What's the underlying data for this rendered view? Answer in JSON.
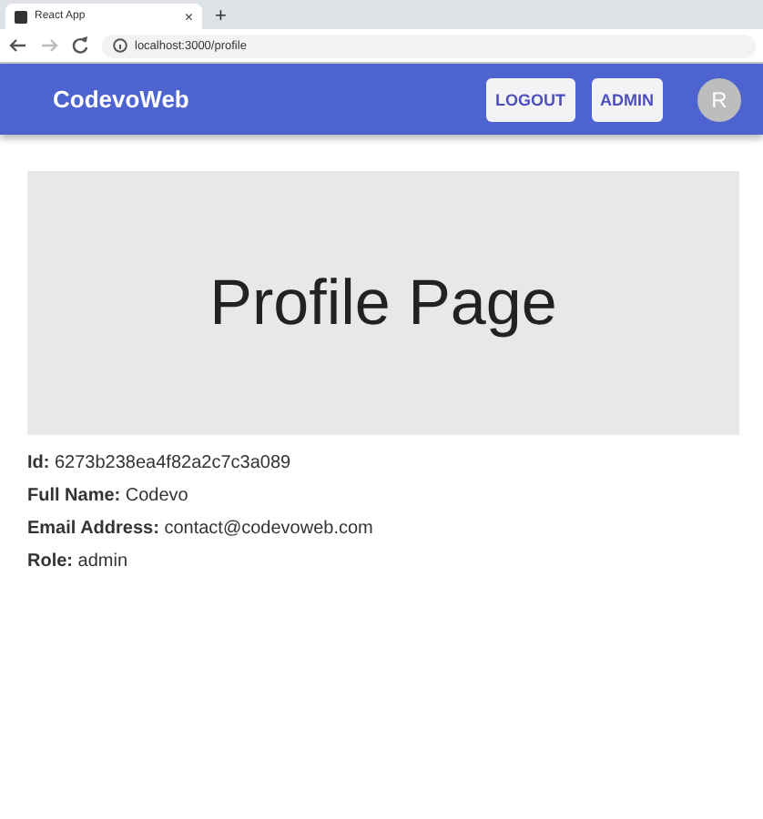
{
  "browser": {
    "tab_title": "React App",
    "new_tab": "+",
    "close_tab": "×",
    "address": "localhost:3000/profile"
  },
  "app_bar": {
    "brand": "CodevoWeb",
    "buttons": [
      "LOGOUT",
      "ADMIN"
    ],
    "avatar": "R"
  },
  "hero": {
    "title": "Profile Page"
  },
  "fields": [
    "**Id:** 6273b238ea4f82a2c7c3a089",
    "**Full Name:** Codevo",
    "**Email Address:** contact@codevoweb.com",
    "**Role:** admin"
  ]
}
